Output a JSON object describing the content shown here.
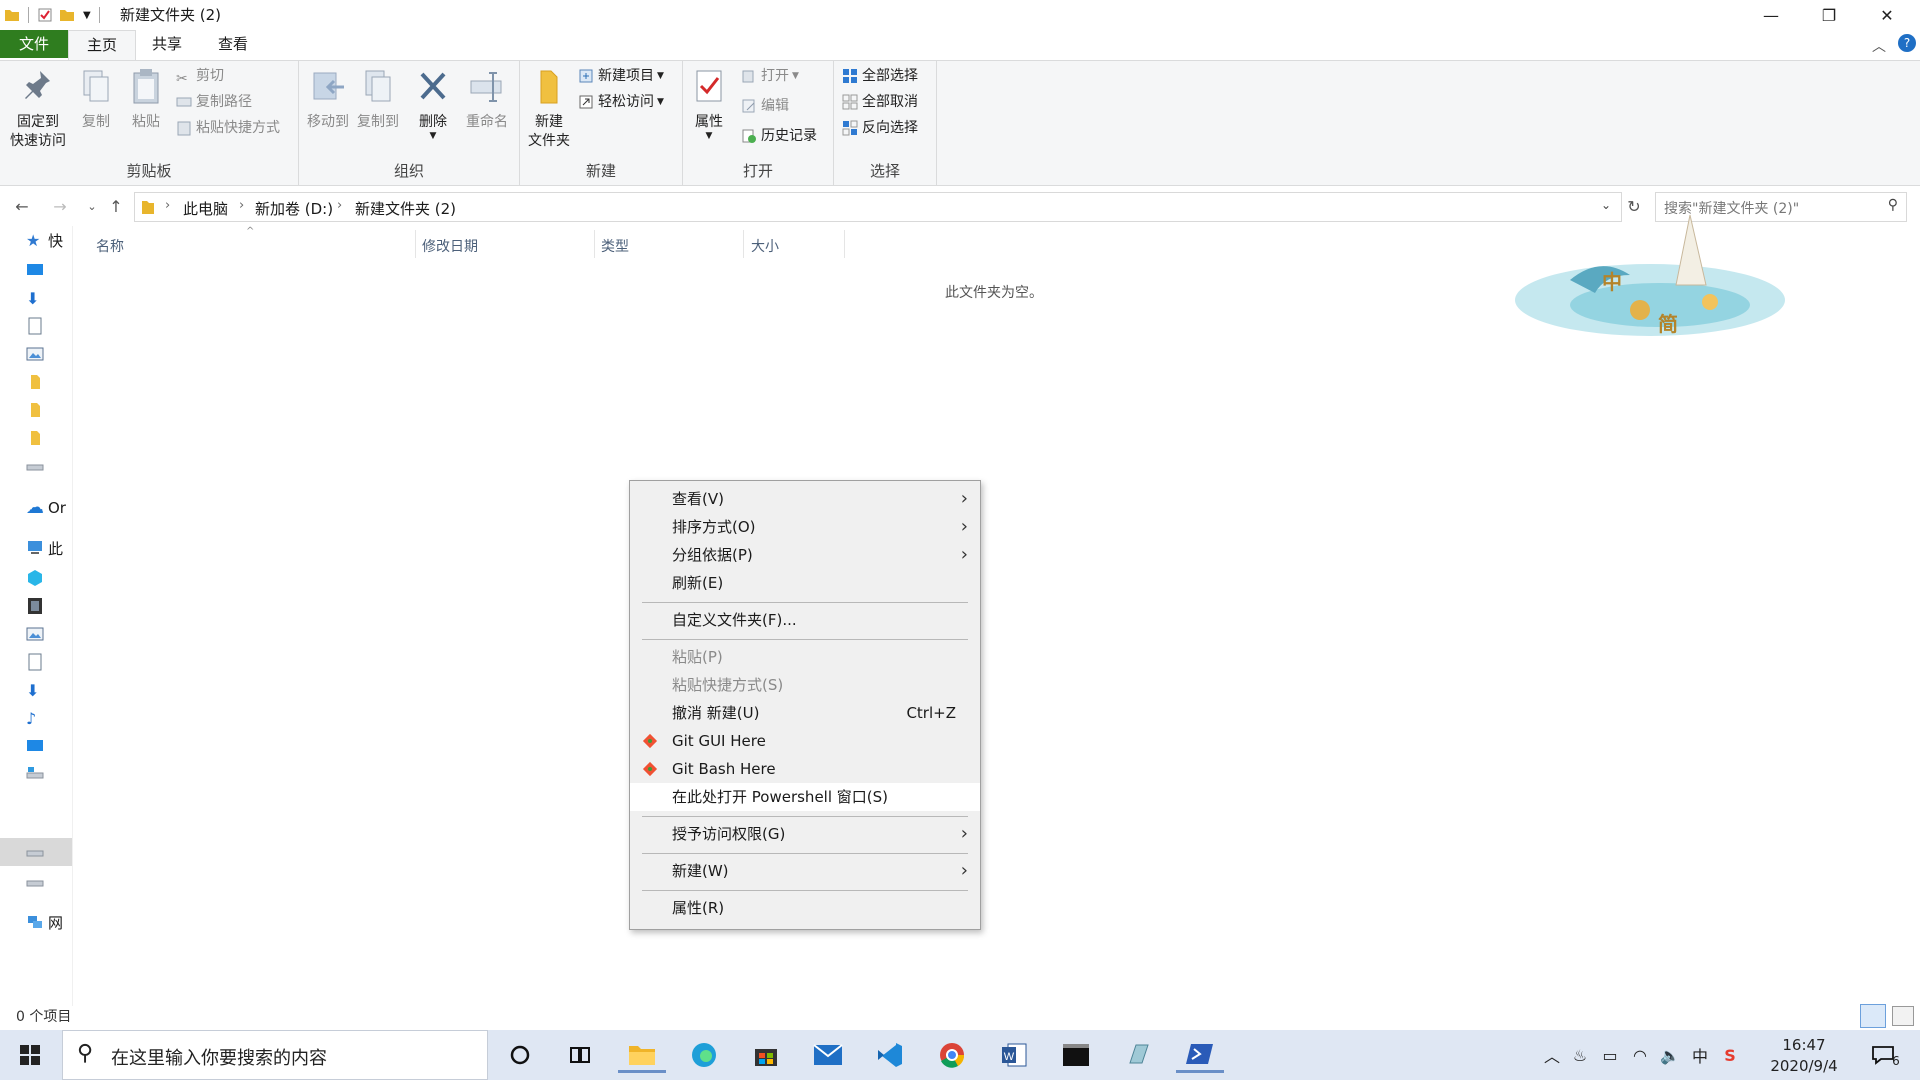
{
  "window": {
    "title": "新建文件夹 (2)",
    "minimize": "—",
    "maximize": "❐",
    "close": "✕"
  },
  "tabs": [
    "文件",
    "主页",
    "共享",
    "查看"
  ],
  "ribbon": {
    "clipboard": {
      "label": "剪贴板",
      "pin": [
        "固定到",
        "快速访问"
      ],
      "copy": "复制",
      "paste": "粘贴",
      "cut": "剪切",
      "copy_path": "复制路径",
      "paste_shortcut": "粘贴快捷方式"
    },
    "organize": {
      "label": "组织",
      "move_to": "移动到",
      "copy_to": "复制到",
      "delete": "删除",
      "rename": "重命名"
    },
    "new": {
      "label": "新建",
      "new_folder": [
        "新建",
        "文件夹"
      ],
      "new_item": "新建项目",
      "easy_access": "轻松访问"
    },
    "open": {
      "label": "打开",
      "properties": "属性",
      "open": "打开",
      "edit": "编辑",
      "history": "历史记录"
    },
    "select": {
      "label": "选择",
      "select_all": "全部选择",
      "select_none": "全部取消",
      "invert": "反向选择"
    }
  },
  "address": {
    "crumbs": [
      "此电脑",
      "新加卷 (D:)",
      "新建文件夹 (2)"
    ],
    "search_placeholder": "搜索\"新建文件夹 (2)\""
  },
  "navpane": {
    "items": [
      "快",
      "",
      "",
      "",
      "",
      "",
      "",
      "",
      "Or",
      "此",
      "",
      "",
      "",
      "",
      "",
      "",
      "",
      "",
      "",
      "",
      "网"
    ]
  },
  "columns": [
    "名称",
    "修改日期",
    "类型",
    "大小"
  ],
  "empty_message": "此文件夹为空。",
  "watermark_text": [
    "中",
    "简"
  ],
  "status": "0 个项目",
  "context_menu": {
    "items": [
      {
        "label": "查看(V)",
        "submenu": true
      },
      {
        "label": "排序方式(O)",
        "submenu": true
      },
      {
        "label": "分组依据(P)",
        "submenu": true
      },
      {
        "label": "刷新(E)"
      },
      {
        "label": "自定义文件夹(F)..."
      },
      {
        "label": "粘贴(P)",
        "disabled": true
      },
      {
        "label": "粘贴快捷方式(S)",
        "disabled": true
      },
      {
        "label": "撤消 新建(U)",
        "shortcut": "Ctrl+Z"
      },
      {
        "label": "Git GUI Here",
        "icon": "git-icon"
      },
      {
        "label": "Git Bash Here",
        "icon": "git-icon"
      },
      {
        "label": "在此处打开 Powershell 窗口(S)",
        "highlighted": true
      },
      {
        "label": "授予访问权限(G)",
        "submenu": true
      },
      {
        "label": "新建(W)",
        "submenu": true
      },
      {
        "label": "属性(R)"
      }
    ]
  },
  "taskbar": {
    "search_placeholder": "在这里输入你要搜索的内容",
    "apps": [
      "cortana-icon",
      "task-view-icon",
      "file-explorer-icon",
      "edge-icon",
      "store-icon",
      "mail-icon",
      "vscode-icon",
      "chrome-icon",
      "word-icon",
      "terminal-icon",
      "app-icon",
      "powershell-icon"
    ],
    "ime": "中",
    "ime2": "S",
    "time": "16:47",
    "date": "2020/9/4",
    "notifications": "6"
  }
}
